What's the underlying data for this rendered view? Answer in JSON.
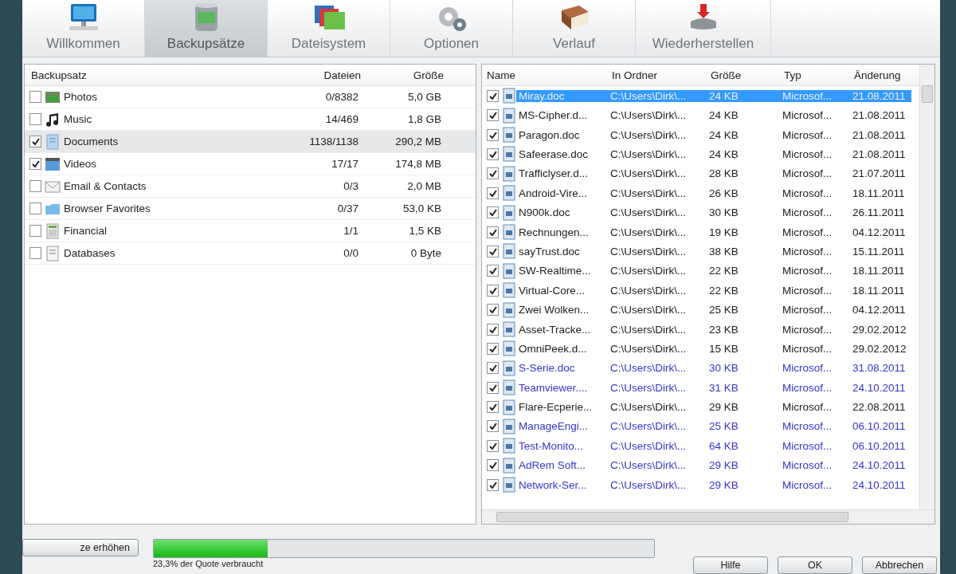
{
  "tabs": [
    {
      "label": "Willkommen",
      "selected": false
    },
    {
      "label": "Backupsätze",
      "selected": true
    },
    {
      "label": "Dateisystem",
      "selected": false
    },
    {
      "label": "Optionen",
      "selected": false
    },
    {
      "label": "Verlauf",
      "selected": false
    },
    {
      "label": "Wiederherstellen",
      "selected": false
    }
  ],
  "backup_sets": {
    "columns": [
      "Backupsatz",
      "Dateien",
      "Größe"
    ],
    "rows": [
      {
        "name": "Photos",
        "kind": "photos",
        "files": "0/8382",
        "size": "5,0 GB",
        "checked": false,
        "selected": false
      },
      {
        "name": "Music",
        "kind": "music",
        "files": "14/469",
        "size": "1,8 GB",
        "checked": false,
        "selected": false
      },
      {
        "name": "Documents",
        "kind": "documents",
        "files": "1138/1138",
        "size": "290,2 MB",
        "checked": true,
        "selected": true
      },
      {
        "name": "Videos",
        "kind": "videos",
        "files": "17/17",
        "size": "174,8 MB",
        "checked": true,
        "selected": false
      },
      {
        "name": "Email & Contacts",
        "kind": "email",
        "files": "0/3",
        "size": "2,0 MB",
        "checked": false,
        "selected": false
      },
      {
        "name": "Browser Favorites",
        "kind": "favorites",
        "files": "0/37",
        "size": "53,0 KB",
        "checked": false,
        "selected": false
      },
      {
        "name": "Financial",
        "kind": "financial",
        "files": "1/1",
        "size": "1,5 KB",
        "checked": false,
        "selected": false
      },
      {
        "name": "Databases",
        "kind": "databases",
        "files": "0/0",
        "size": "0 Byte",
        "checked": false,
        "selected": false
      }
    ]
  },
  "files": {
    "columns": [
      "Name",
      "In Ordner",
      "Größe",
      "Typ",
      "Änderung"
    ],
    "rows": [
      {
        "name": "Miray.doc",
        "folder": "C:\\Users\\Dirk\\...",
        "size": "24 KB",
        "type": "Microsof...",
        "modified": "21.08.2011",
        "checked": true,
        "selected": true,
        "compressed": false
      },
      {
        "name": "MS-Cipher.d...",
        "folder": "C:\\Users\\Dirk\\...",
        "size": "24 KB",
        "type": "Microsof...",
        "modified": "21.08.2011",
        "checked": true,
        "selected": false,
        "compressed": false
      },
      {
        "name": "Paragon.doc",
        "folder": "C:\\Users\\Dirk\\...",
        "size": "24 KB",
        "type": "Microsof...",
        "modified": "21.08.2011",
        "checked": true,
        "selected": false,
        "compressed": false
      },
      {
        "name": "Safeerase.doc",
        "folder": "C:\\Users\\Dirk\\...",
        "size": "24 KB",
        "type": "Microsof...",
        "modified": "21.08.2011",
        "checked": true,
        "selected": false,
        "compressed": false
      },
      {
        "name": "Trafficlyser.d...",
        "folder": "C:\\Users\\Dirk\\...",
        "size": "28 KB",
        "type": "Microsof...",
        "modified": "21.07.2011",
        "checked": true,
        "selected": false,
        "compressed": false
      },
      {
        "name": "Android-Vire...",
        "folder": "C:\\Users\\Dirk\\...",
        "size": "26 KB",
        "type": "Microsof...",
        "modified": "18.11.2011",
        "checked": true,
        "selected": false,
        "compressed": false
      },
      {
        "name": "N900k.doc",
        "folder": "C:\\Users\\Dirk\\...",
        "size": "30 KB",
        "type": "Microsof...",
        "modified": "26.11.2011",
        "checked": true,
        "selected": false,
        "compressed": false
      },
      {
        "name": "Rechnungen...",
        "folder": "C:\\Users\\Dirk\\...",
        "size": "19 KB",
        "type": "Microsof...",
        "modified": "04.12.2011",
        "checked": true,
        "selected": false,
        "compressed": false
      },
      {
        "name": "sayTrust.doc",
        "folder": "C:\\Users\\Dirk\\...",
        "size": "38 KB",
        "type": "Microsof...",
        "modified": "15.11.2011",
        "checked": true,
        "selected": false,
        "compressed": false
      },
      {
        "name": "SW-Realtime...",
        "folder": "C:\\Users\\Dirk\\...",
        "size": "22 KB",
        "type": "Microsof...",
        "modified": "18.11.2011",
        "checked": true,
        "selected": false,
        "compressed": false
      },
      {
        "name": "Virtual-Core...",
        "folder": "C:\\Users\\Dirk\\...",
        "size": "22 KB",
        "type": "Microsof...",
        "modified": "18.11.2011",
        "checked": true,
        "selected": false,
        "compressed": false
      },
      {
        "name": "Zwei Wolken...",
        "folder": "C:\\Users\\Dirk\\...",
        "size": "25 KB",
        "type": "Microsof...",
        "modified": "04.12.2011",
        "checked": true,
        "selected": false,
        "compressed": false
      },
      {
        "name": "Asset-Tracke...",
        "folder": "C:\\Users\\Dirk\\...",
        "size": "23 KB",
        "type": "Microsof...",
        "modified": "29.02.2012",
        "checked": true,
        "selected": false,
        "compressed": false
      },
      {
        "name": "OmniPeek.d...",
        "folder": "C:\\Users\\Dirk\\...",
        "size": "15 KB",
        "type": "Microsof...",
        "modified": "29.02.2012",
        "checked": true,
        "selected": false,
        "compressed": false
      },
      {
        "name": "S-Serie.doc",
        "folder": "C:\\Users\\Dirk\\...",
        "size": "30 KB",
        "type": "Microsof...",
        "modified": "31.08.2011",
        "checked": true,
        "selected": false,
        "compressed": true
      },
      {
        "name": "Teamviewer....",
        "folder": "C:\\Users\\Dirk\\...",
        "size": "31 KB",
        "type": "Microsof...",
        "modified": "24.10.2011",
        "checked": true,
        "selected": false,
        "compressed": true
      },
      {
        "name": "Flare-Ecperie...",
        "folder": "C:\\Users\\Dirk\\...",
        "size": "29 KB",
        "type": "Microsof...",
        "modified": "22.08.2011",
        "checked": true,
        "selected": false,
        "compressed": false
      },
      {
        "name": "ManageEngi...",
        "folder": "C:\\Users\\Dirk\\...",
        "size": "25 KB",
        "type": "Microsof...",
        "modified": "06.10.2011",
        "checked": true,
        "selected": false,
        "compressed": true
      },
      {
        "name": "Test-Monito...",
        "folder": "C:\\Users\\Dirk\\...",
        "size": "64 KB",
        "type": "Microsof...",
        "modified": "06.10.2011",
        "checked": true,
        "selected": false,
        "compressed": true
      },
      {
        "name": "AdRem Soft...",
        "folder": "C:\\Users\\Dirk\\...",
        "size": "29 KB",
        "type": "Microsof...",
        "modified": "24.10.2011",
        "checked": true,
        "selected": false,
        "compressed": true
      },
      {
        "name": "Network-Ser...",
        "folder": "C:\\Users\\Dirk\\...",
        "size": "29 KB",
        "type": "Microsof...",
        "modified": "24.10.2011",
        "checked": true,
        "selected": false,
        "compressed": true
      }
    ]
  },
  "quota": {
    "button": "ze erhöhen",
    "level": 0.227,
    "caption": "23,3% der Quote verbraucht"
  },
  "buttons": [
    "Hilfe",
    "OK",
    "Abbrechen"
  ]
}
